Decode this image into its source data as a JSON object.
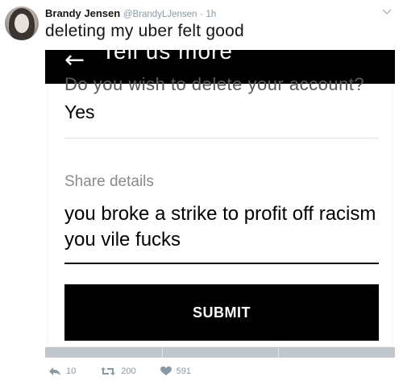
{
  "tweet": {
    "author_name": "Brandy Jensen",
    "author_handle": "@BrandyLJensen",
    "separator": "·",
    "timestamp": "1h",
    "text": "deleting my uber felt good"
  },
  "card": {
    "header_title": "Tell us more",
    "cut_question": "Do you wish to delete your account?",
    "answer": "Yes",
    "share_label": "Share details",
    "share_value": "you broke a strike to profit off racism you vile fucks",
    "submit_label": "SUBMIT"
  },
  "actions": {
    "reply_count": "10",
    "retweet_count": "200",
    "like_count": "591"
  },
  "icons": {
    "back": "back-arrow-icon",
    "menu": "chevron-down-icon",
    "reply": "reply-icon",
    "retweet": "retweet-icon",
    "like": "heart-icon"
  },
  "colors": {
    "text": "#14171a",
    "muted": "#8899a6",
    "card_black": "#000000"
  }
}
